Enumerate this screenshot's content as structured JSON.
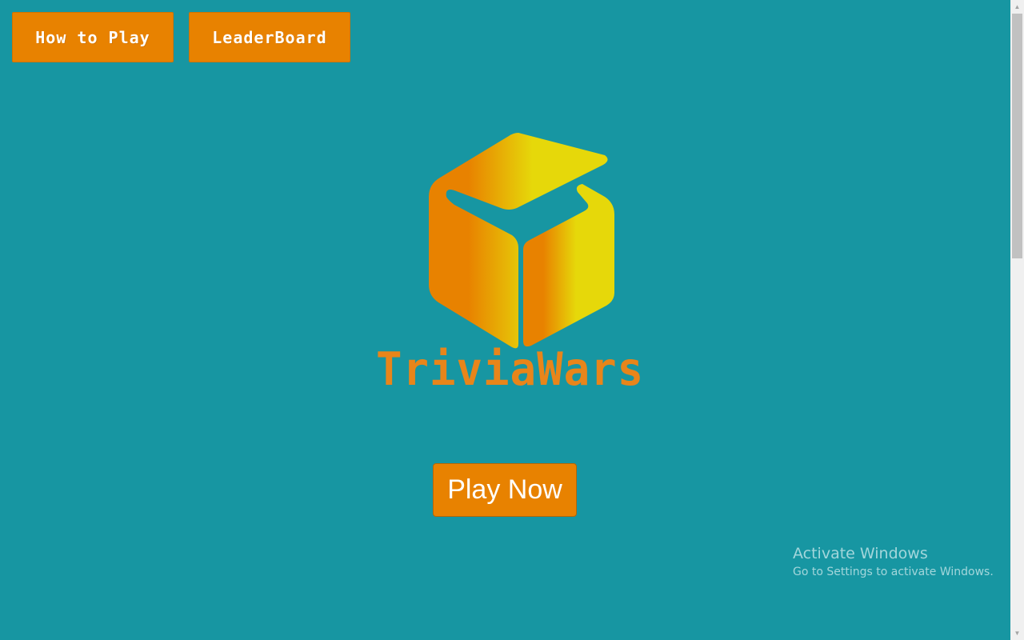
{
  "nav": {
    "how_to_play_label": "How to Play",
    "leaderboard_label": "LeaderBoard"
  },
  "logo": {
    "text": "TriviaWars",
    "icon": "cube-logo-icon"
  },
  "main": {
    "play_now_label": "Play Now"
  },
  "watermark": {
    "title": "Activate Windows",
    "subtitle": "Go to Settings to activate Windows."
  },
  "colors": {
    "background": "#1796a2",
    "button": "#e88200",
    "logo_orange": "#e88200",
    "logo_yellow": "#e6d80a"
  }
}
